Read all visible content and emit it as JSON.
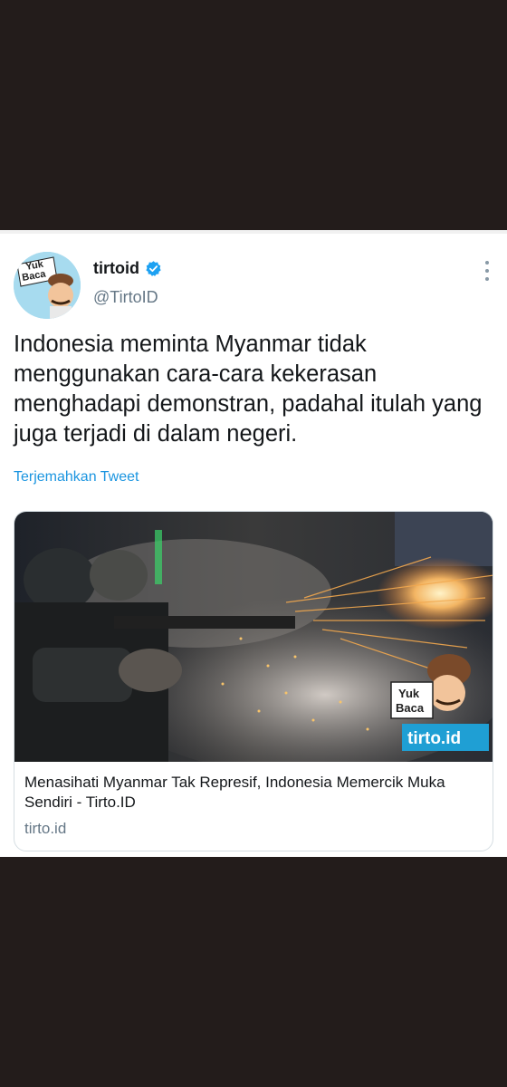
{
  "tweet": {
    "display_name": "tirtoid",
    "handle": "@TirtoID",
    "text": "Indonesia meminta Myanmar tidak menggunakan cara-cara kekerasan menghadapi demonstran, padahal itulah yang juga terjadi di dalam negeri.",
    "translate_label": "Terjemahkan Tweet",
    "avatar_text_line1": "Yuk",
    "avatar_text_line2": "Baca"
  },
  "card": {
    "title": "Menasihati Myanmar Tak Represif, Indonesia Memercik Muka Sendiri - Tirto.ID",
    "domain": "tirto.id",
    "overlay_line1": "Yuk",
    "overlay_line2": "Baca",
    "overlay_brand": "tirto.id"
  },
  "icons": {
    "verified": "verified-badge-icon",
    "more": "more-options-icon"
  },
  "colors": {
    "background": "#231c1b",
    "accent": "#1b95e0",
    "card_border": "#d6dee3"
  }
}
